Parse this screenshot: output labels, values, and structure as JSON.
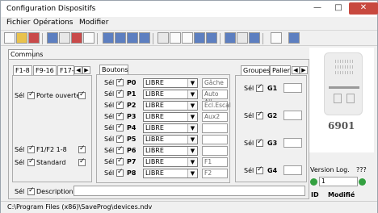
{
  "app": {
    "title": "Configuration Dispositifs"
  },
  "menus": [
    "Fichier",
    "Opérations",
    "Modifier"
  ],
  "tabs": {
    "main": "Communs",
    "left": [
      "F1-8",
      "F9-16",
      "F17-"
    ],
    "center": "Boutons",
    "right": [
      "Groupes",
      "Palier"
    ]
  },
  "left": {
    "row1": "Porte ouverte",
    "row2": "F1/F2 1-8",
    "row3": "Standard",
    "sel": "Sél"
  },
  "buttons": [
    {
      "label": "P0",
      "value": "LIBRE",
      "extra": "Gâche"
    },
    {
      "label": "P1",
      "value": "LIBRE",
      "extra": "Auto All."
    },
    {
      "label": "P2",
      "value": "LIBRE",
      "extra": "Ecl.Escal"
    },
    {
      "label": "P3",
      "value": "LIBRE",
      "extra": "Aux2"
    },
    {
      "label": "P4",
      "value": "LIBRE",
      "extra": ""
    },
    {
      "label": "P5",
      "value": "LIBRE",
      "extra": ""
    },
    {
      "label": "P6",
      "value": "LIBRE",
      "extra": ""
    },
    {
      "label": "P7",
      "value": "LIBRE",
      "extra": "F1"
    },
    {
      "label": "P8",
      "value": "LIBRE",
      "extra": "F2"
    }
  ],
  "groups": [
    {
      "label": "G1"
    },
    {
      "label": "G2"
    },
    {
      "label": "G3"
    },
    {
      "label": "G4"
    }
  ],
  "device": {
    "model": "6901"
  },
  "version": {
    "label": "Version Log.",
    "value": "???",
    "id_label": "ID",
    "modified_label": "Modifié",
    "spinner": "1"
  },
  "description": {
    "label": "Description",
    "value": ""
  },
  "status": {
    "path": "C:\\Program Files (x86)\\SaveProg\\devices.ndv"
  }
}
